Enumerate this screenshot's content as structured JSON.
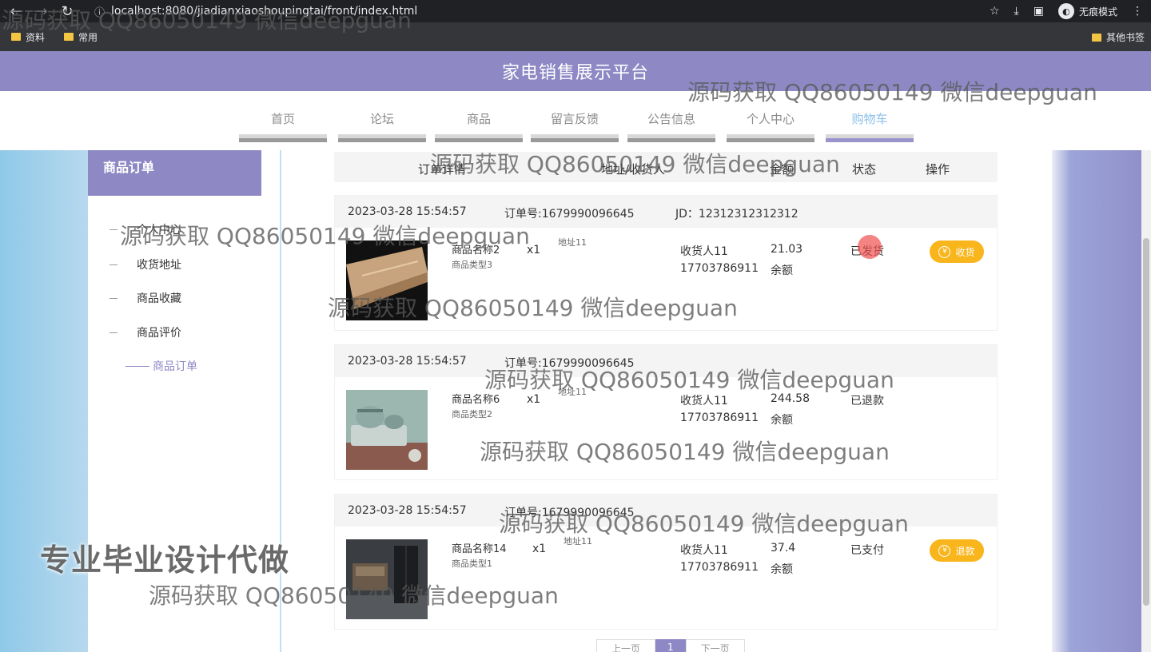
{
  "browser": {
    "url": "localhost:8080/jiadianxiaoshoupingtai/front/index.html",
    "incognito_label": "无痕模式",
    "bookmarks": [
      "资料",
      "常用"
    ],
    "other_bookmarks": "其他书签"
  },
  "site": {
    "title": "家电销售展示平台",
    "nav": [
      {
        "label": "首页"
      },
      {
        "label": "论坛"
      },
      {
        "label": "商品"
      },
      {
        "label": "留言反馈"
      },
      {
        "label": "公告信息"
      },
      {
        "label": "个人中心"
      },
      {
        "label": "购物车",
        "active": true
      }
    ]
  },
  "sidebar": {
    "title": "商品订单",
    "items": [
      {
        "label": "个人中心"
      },
      {
        "label": "收货地址"
      },
      {
        "label": "商品收藏"
      },
      {
        "label": "商品评价"
      },
      {
        "label": "商品订单",
        "active": true
      }
    ]
  },
  "table": {
    "headers": [
      "订单详情",
      "地址/收货人",
      "金额",
      "状态",
      "操作"
    ]
  },
  "orders": [
    {
      "datetime": "2023-03-28 15:54:57",
      "order_no": "订单号:1679990096645",
      "jd": "JD：12312312312312",
      "product_name": "商品名称2",
      "product_type": "商品类型3",
      "qty": "x1",
      "address": "地址11",
      "receiver": "收货人11",
      "phone": "17703786911",
      "amount": "21.03",
      "pay_method": "余额",
      "status": "已发货",
      "action": "收货"
    },
    {
      "datetime": "2023-03-28 15:54:57",
      "order_no": "订单号:1679990096645",
      "jd": "",
      "product_name": "商品名称6",
      "product_type": "商品类型2",
      "qty": "x1",
      "address": "地址11",
      "receiver": "收货人11",
      "phone": "17703786911",
      "amount": "244.58",
      "pay_method": "余额",
      "status": "已退款",
      "action": ""
    },
    {
      "datetime": "2023-03-28 15:54:57",
      "order_no": "订单号:1679990096645",
      "jd": "",
      "product_name": "商品名称14",
      "product_type": "商品类型1",
      "qty": "x1",
      "address": "地址11",
      "receiver": "收货人11",
      "phone": "17703786911",
      "amount": "37.4",
      "pay_method": "余额",
      "status": "已支付",
      "action": "退款"
    }
  ],
  "pager": {
    "prev": "上一页",
    "current": "1",
    "next": "下一页"
  },
  "watermark": {
    "text": "源码获取 QQ86050149 微信deepguan",
    "big": "专业毕业设计代做"
  },
  "colors": {
    "header": "#8e88c4",
    "action": "#f8b51c",
    "active_nav": "#8dc0ea"
  }
}
